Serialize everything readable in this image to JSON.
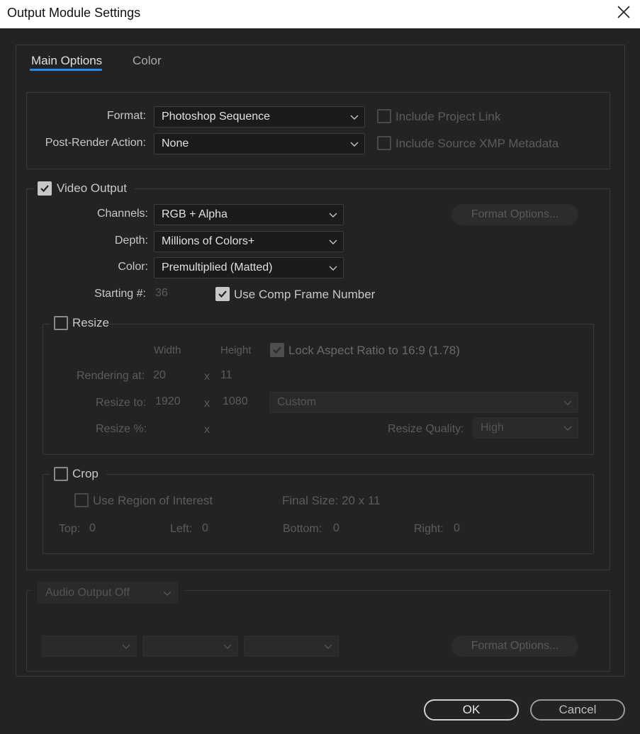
{
  "window": {
    "title": "Output Module Settings"
  },
  "tabs": [
    {
      "label": "Main Options",
      "active": true
    },
    {
      "label": "Color",
      "active": false
    }
  ],
  "format": {
    "format_label": "Format:",
    "format_value": "Photoshop Sequence",
    "post_render_label": "Post-Render Action:",
    "post_render_value": "None",
    "include_project_link": "Include Project Link",
    "include_source_xmp": "Include Source XMP Metadata"
  },
  "video_output": {
    "label": "Video Output",
    "checked": true,
    "channels_label": "Channels:",
    "channels_value": "RGB + Alpha",
    "depth_label": "Depth:",
    "depth_value": "Millions of Colors+",
    "color_label": "Color:",
    "color_value": "Premultiplied (Matted)",
    "starting_label": "Starting #:",
    "starting_value": "36",
    "use_comp_frame": "Use Comp Frame Number",
    "format_options": "Format Options..."
  },
  "resize": {
    "label": "Resize",
    "width_header": "Width",
    "height_header": "Height",
    "lock_aspect": "Lock Aspect Ratio to 16:9 (1.78)",
    "rendering_at_label": "Rendering at:",
    "rendering_w": "20",
    "rendering_h": "11",
    "resize_to_label": "Resize to:",
    "resize_w": "1920",
    "resize_h": "1080",
    "preset_value": "Custom",
    "resize_pct_label": "Resize %:",
    "x": "x",
    "quality_label": "Resize Quality:",
    "quality_value": "High"
  },
  "crop": {
    "label": "Crop",
    "use_roi": "Use Region of Interest",
    "final_size": "Final Size: 20 x 11",
    "top_label": "Top:",
    "top_value": "0",
    "left_label": "Left:",
    "left_value": "0",
    "bottom_label": "Bottom:",
    "bottom_value": "0",
    "right_label": "Right:",
    "right_value": "0"
  },
  "audio": {
    "output_value": "Audio Output Off",
    "format_options": "Format Options..."
  },
  "buttons": {
    "ok": "OK",
    "cancel": "Cancel"
  }
}
